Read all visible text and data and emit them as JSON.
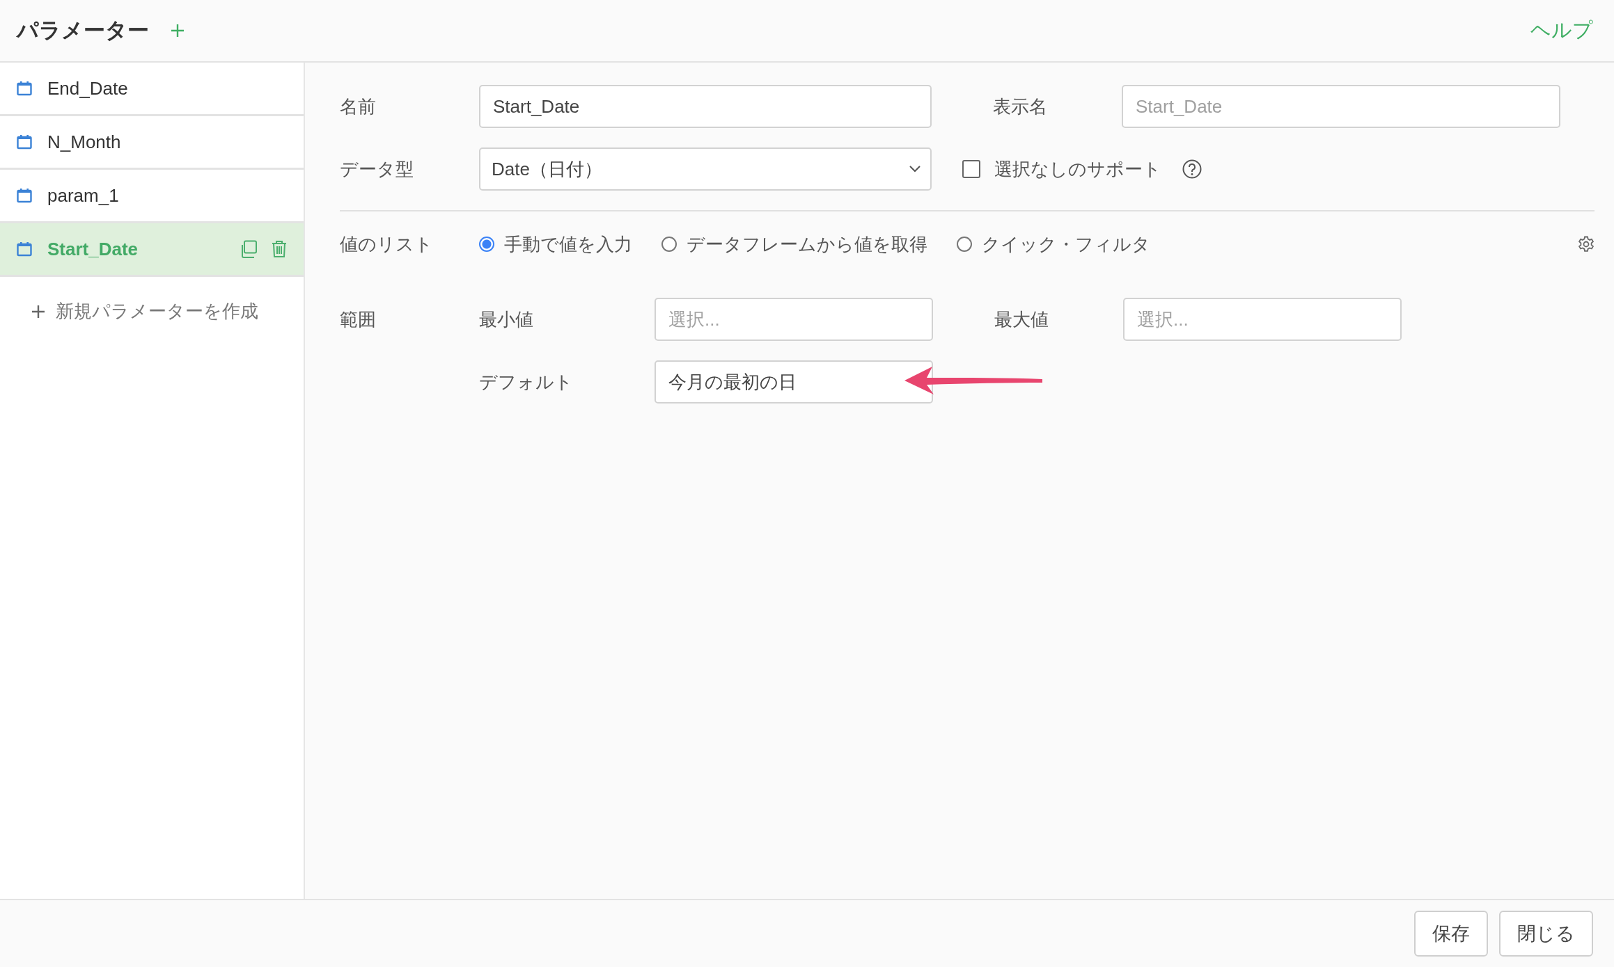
{
  "header": {
    "title": "パラメーター",
    "help_link": "ヘルプ"
  },
  "sidebar": {
    "items": [
      {
        "label": "End_Date",
        "selected": false
      },
      {
        "label": "N_Month",
        "selected": false
      },
      {
        "label": "param_1",
        "selected": false
      },
      {
        "label": "Start_Date",
        "selected": true
      }
    ],
    "create_link": "新規パラメーターを作成"
  },
  "form": {
    "name": {
      "label": "名前",
      "value": "Start_Date"
    },
    "display_name": {
      "label": "表示名",
      "placeholder": "Start_Date"
    },
    "data_type": {
      "label": "データ型",
      "value": "Date（日付）"
    },
    "support_none": {
      "label": "選択なしのサポート",
      "checked": false
    },
    "value_list": {
      "label": "値のリスト",
      "options": [
        {
          "label": "手動で値を入力",
          "selected": true
        },
        {
          "label": "データフレームから値を取得",
          "selected": false
        },
        {
          "label": "クイック・フィルタ",
          "selected": false
        }
      ]
    },
    "range": {
      "label": "範囲",
      "min": {
        "label": "最小値",
        "placeholder": "選択..."
      },
      "max": {
        "label": "最大値",
        "placeholder": "選択..."
      },
      "default": {
        "label": "デフォルト",
        "value": "今月の最初の日"
      }
    }
  },
  "footer": {
    "buttons": [
      "保存",
      "閉じる"
    ]
  }
}
